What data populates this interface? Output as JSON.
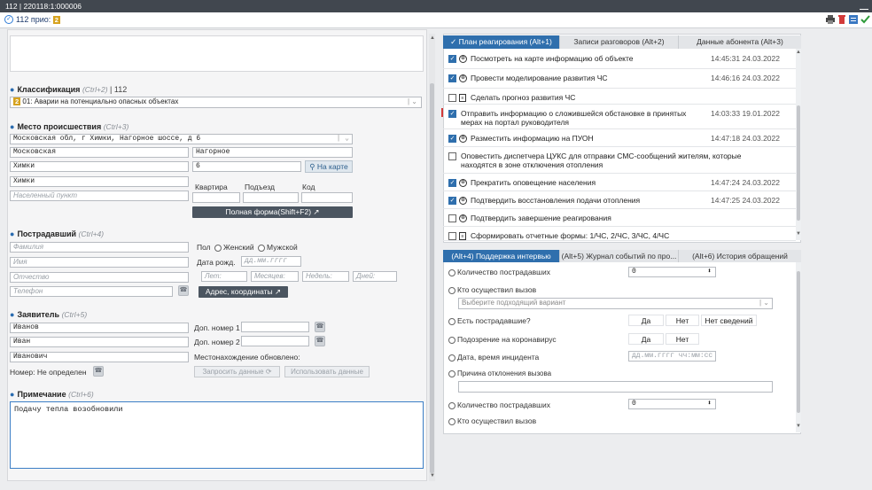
{
  "window": {
    "title": "112 | 220118:1:000006"
  },
  "subbar": {
    "label": "112 прио:",
    "priority": "2"
  },
  "left": {
    "classification": {
      "title": "Классификация",
      "hint": "(Ctrl+2)",
      "suffix": "| 112",
      "badge": "2",
      "value": "01: Аварии на потенциально опасных объектах"
    },
    "location": {
      "title": "Место происшествия",
      "hint": "(Ctrl+3)",
      "address": "Московская обл, г Химки, Нагорное шоссе, д 6",
      "region": "Московская",
      "street": "Нагорное",
      "city": "Химки",
      "house": "6",
      "map_button": "На карте",
      "city2": "Химки",
      "settlement_placeholder": "Населенный пункт",
      "apartment_label": "Квартира",
      "entrance_label": "Подъезд",
      "code_label": "Код",
      "full_form_button": "Полная форма(Shift+F2) ↗"
    },
    "victim": {
      "title": "Пострадавший",
      "hint": "(Ctrl+4)",
      "surname_ph": "Фамилия",
      "name_ph": "Имя",
      "patronymic_ph": "Отчество",
      "phone_ph": "Телефон",
      "sex_label": "Пол",
      "female": "Женский",
      "male": "Мужской",
      "dob_label": "Дата рожд.",
      "dob_ph": "дд.мм.гггг",
      "years_ph": "Лет:",
      "months_ph": "Месяцев:",
      "weeks_ph": "Недель:",
      "days_ph": "Дней:",
      "address_button": "Адрес, координаты ↗"
    },
    "applicant": {
      "title": "Заявитель",
      "hint": "(Ctrl+5)",
      "surname": "Иванов",
      "name": "Иван",
      "patronymic": "Иванович",
      "phone2_label": "Доп. номер 1",
      "phone3_label": "Доп. номер 2",
      "location_updated": "Местонахождение обновлено:",
      "number_label": "Номер:",
      "number_value": "Не определен",
      "request_button": "Запросить данные",
      "use_button": "Использовать данные"
    },
    "note": {
      "title": "Примечание",
      "hint": "(Ctrl+6)",
      "value": "Подачу тепла возобновили"
    }
  },
  "plan": {
    "tabs": [
      "План реагирования (Alt+1)",
      "Записи разговоров (Alt+2)",
      "Данные абонента (Alt+3)"
    ],
    "items": [
      {
        "text": "Посмотреть на карте информацию об объекте",
        "time": "14:45:31 24.03.2022",
        "checked": true,
        "icon": "globe-icon"
      },
      {
        "text": "Провести моделирование развития ЧС",
        "time": "14:46:16 24.03.2022",
        "checked": true,
        "icon": "globe-icon"
      },
      {
        "text": "Сделать прогноз развития ЧС",
        "time": "",
        "checked": false,
        "icon": "doc-icon"
      },
      {
        "text": "Отправить информацию о сложившейся обстановке в принятых мерах на портал руководителя",
        "time": "14:03:33 19.01.2022",
        "checked": true,
        "icon": ""
      },
      {
        "text": "Разместить информацию на ПУОН",
        "time": "14:47:18 24.03.2022",
        "checked": true,
        "icon": "globe-icon"
      },
      {
        "text": "Оповестить диспетчера ЦУКС для отправки СМС-сообщений жителям, которые находятся в зоне отключения отопления",
        "time": "",
        "checked": false,
        "icon": ""
      },
      {
        "text": "Прекратить оповещение населения",
        "time": "14:47:24 24.03.2022",
        "checked": true,
        "icon": "globe-icon"
      },
      {
        "text": "Подтвердить восстановления подачи отопления",
        "time": "14:47:25 24.03.2022",
        "checked": true,
        "icon": "globe-icon"
      },
      {
        "text": "Подтвердить завершение реагирования",
        "time": "",
        "checked": false,
        "icon": "globe-icon"
      },
      {
        "text": "Сформировать отчетные формы: 1/ЧС, 2/ЧС, 3/ЧС, 4/ЧС",
        "time": "",
        "checked": false,
        "icon": "doc-icon"
      }
    ]
  },
  "support": {
    "tabs": [
      "(Alt+4) Поддержка интервью",
      "(Alt+5) Журнал событий по про...",
      "(Alt+6) История обращений"
    ],
    "victims_count": "Количество пострадавших",
    "count_value": "0",
    "who_called": "Кто осуществил вызов",
    "select_ph": "Выберите подходящий вариант",
    "has_victims": "Есть пострадавшие?",
    "yes": "Да",
    "no": "Нет",
    "no_info": "Нет сведений",
    "covid": "Подозрение на коронавирус",
    "incident_dt": "Дата, время инцидента",
    "dt_ph": "дд.мм.гггг чч:мм:сс",
    "reject_reason": "Причина отклонения вызова",
    "victims_count2": "Количество пострадавших",
    "count_value2": "0",
    "who_called2": "Кто осуществил вызов"
  }
}
